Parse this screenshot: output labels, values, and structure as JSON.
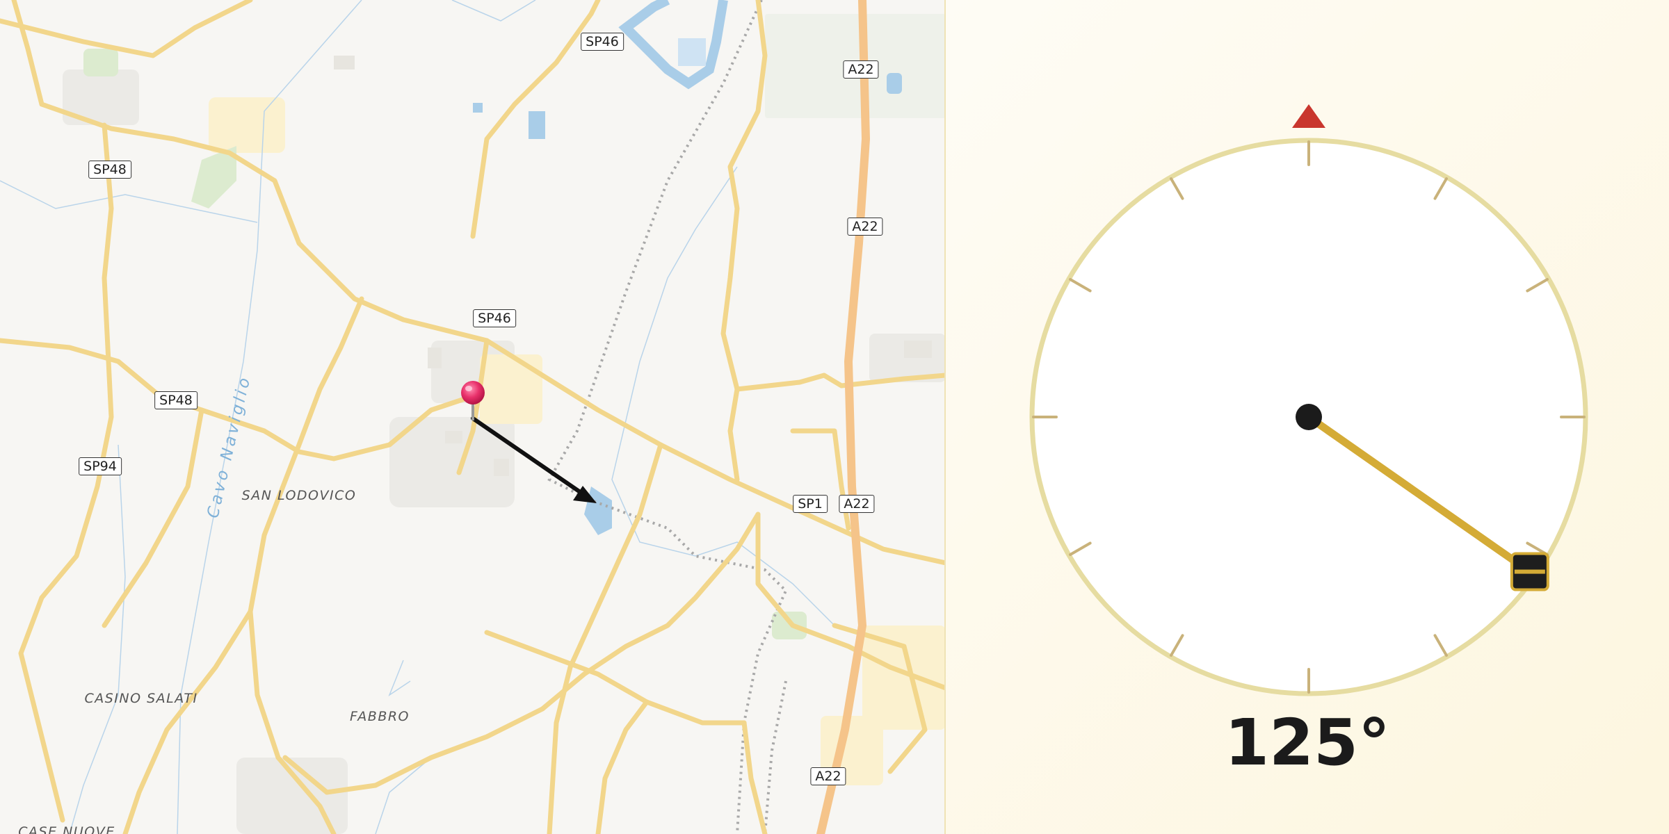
{
  "map": {
    "road_shields": [
      "SP46",
      "A22",
      "SP48",
      "A22",
      "SP46",
      "SP48",
      "SP94",
      "SP1",
      "A22",
      "A22"
    ],
    "place_labels": [
      "SAN LODOVICO",
      "CASINO SALATI",
      "FABBRO",
      "CASE NUOVE"
    ],
    "water_label": "Cavo Naviglio",
    "pin_icon": "map-pin-icon",
    "direction_arrow_icon": "direction-arrow-icon"
  },
  "compass": {
    "heading_deg": 125,
    "heading_text": "125°",
    "north_marker_icon": "north-triangle-icon",
    "needle_color": "#d4ab36",
    "north_color": "#c9362e"
  }
}
